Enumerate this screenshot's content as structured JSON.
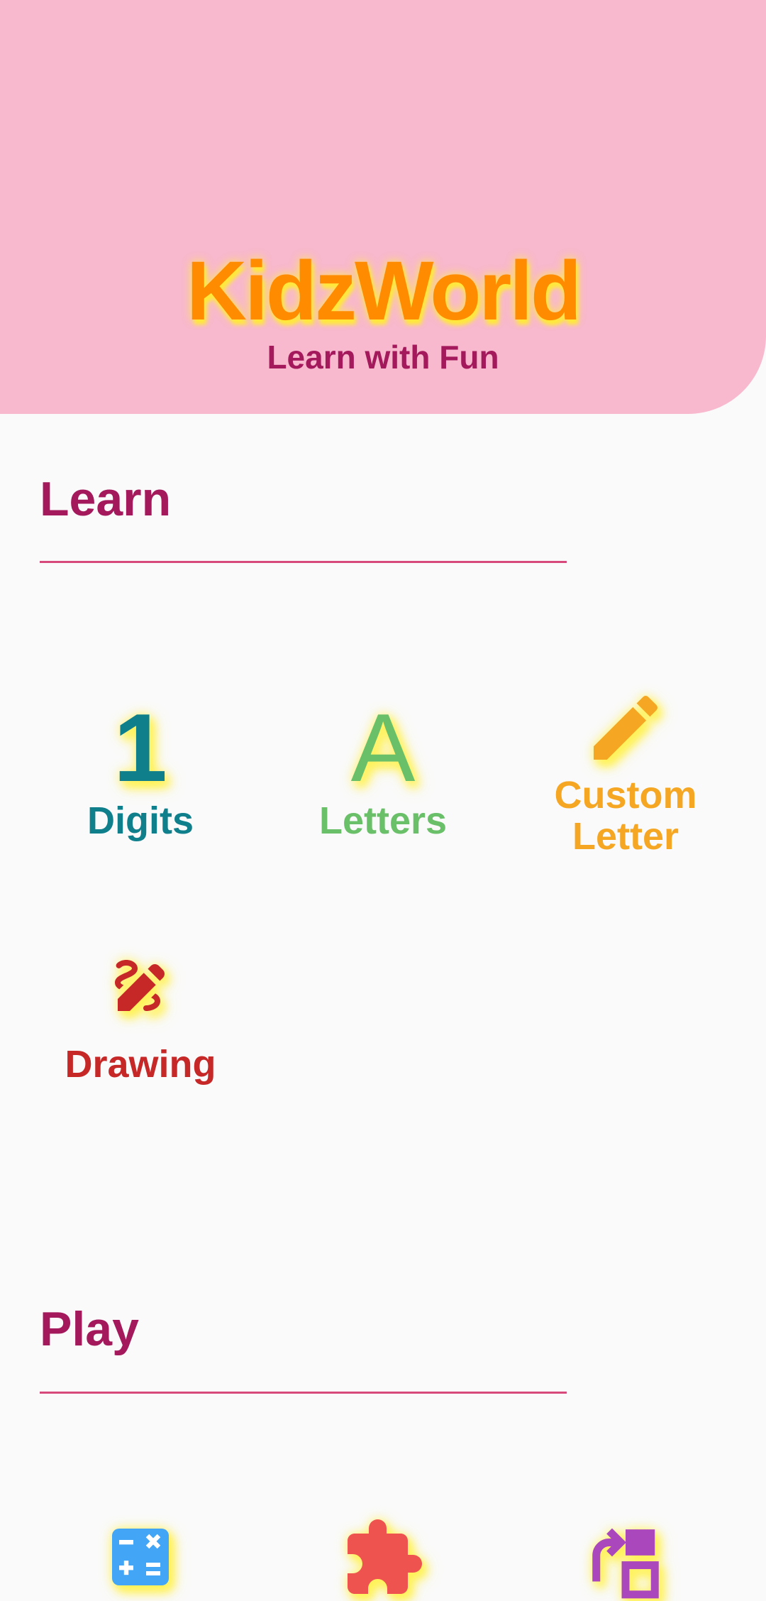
{
  "header": {
    "title": "KidzWorld",
    "subtitle": "Learn with Fun"
  },
  "learn": {
    "title": "Learn",
    "items": [
      {
        "glyph": "1",
        "label": "Digits",
        "color": "#0f7f8c"
      },
      {
        "glyph": "A",
        "label": "Letters",
        "color": "#6abf69"
      },
      {
        "icon": "pencil-icon",
        "label_line1": "Custom",
        "label_line2": "Letter",
        "color": "#f5a623"
      },
      {
        "icon": "drawing-icon",
        "label": "Drawing",
        "color": "#c62828"
      }
    ]
  },
  "play": {
    "title": "Play",
    "items": [
      {
        "icon": "calculator-icon",
        "color": "#42a5f5"
      },
      {
        "icon": "puzzle-icon",
        "color": "#ef5350"
      },
      {
        "icon": "shapes-rotate-icon",
        "color": "#ab47bc"
      }
    ]
  }
}
